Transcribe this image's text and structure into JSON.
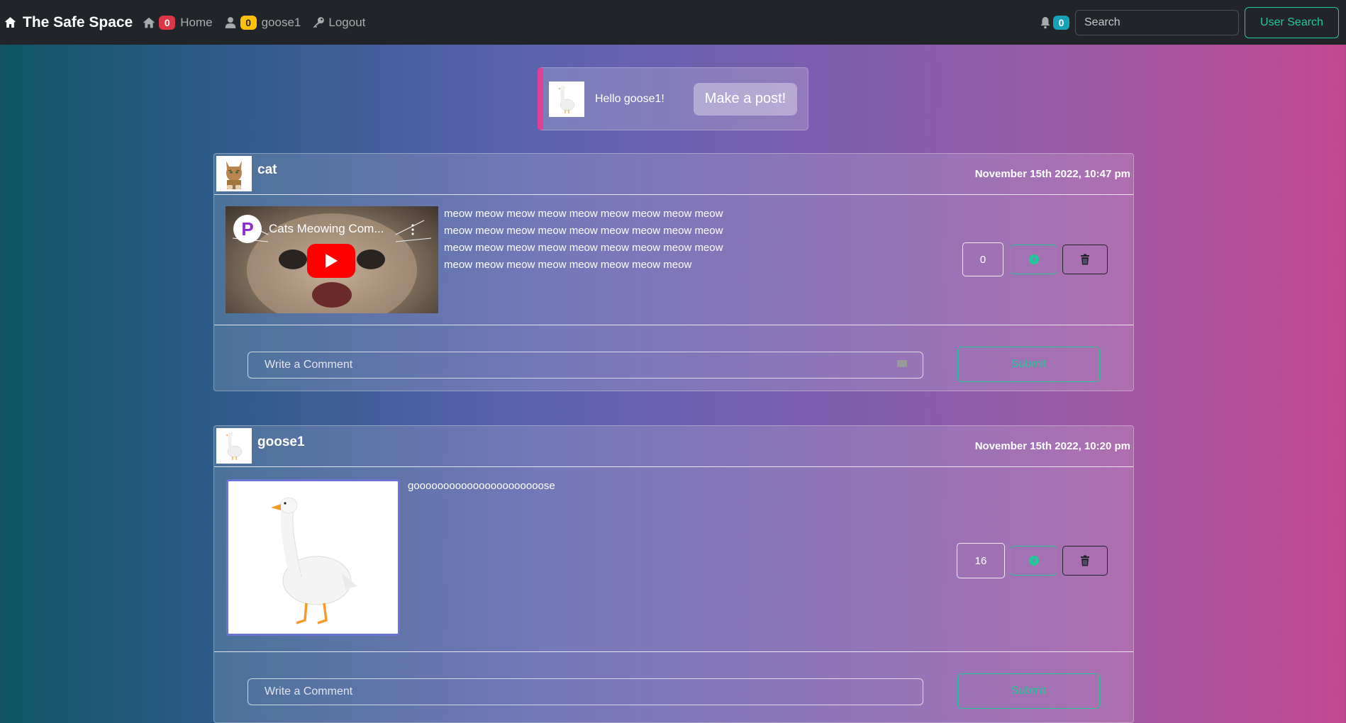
{
  "navbar": {
    "brand": "The Safe Space",
    "home_badge": "0",
    "home_label": "Home",
    "user_badge": "0",
    "user_label": "goose1",
    "logout_label": "Logout",
    "notification_badge": "0",
    "search_placeholder": "Search",
    "user_search_label": "User Search"
  },
  "greeting": {
    "text": "Hello goose1!",
    "make_post_label": "Make a post!"
  },
  "posts": [
    {
      "username": "cat",
      "date": "November 15th 2022, 10:47 pm",
      "video_title": "Cats Meowing Com...",
      "video_logo": "P",
      "text_lines": [
        "meow meow meow meow meow meow meow meow meow",
        "meow meow meow meow meow meow meow meow meow",
        "meow meow meow meow meow meow meow meow meow",
        "meow meow meow meow meow meow meow meow"
      ],
      "votes": "0",
      "comment_placeholder": "Write a Comment",
      "submit_label": "Submit"
    },
    {
      "username": "goose1",
      "date": "November 15th 2022, 10:20 pm",
      "text": "goooooooooooooooooooooose",
      "votes": "16",
      "comment_placeholder": "Write a Comment",
      "submit_label": "Submit"
    }
  ],
  "colors": {
    "navbar_bg": "#212529",
    "accent_teal": "#20c997",
    "badge_red": "#dc3545",
    "badge_yellow": "#ffc107",
    "badge_cyan": "#17a2b8",
    "greeting_border": "#e04098"
  }
}
